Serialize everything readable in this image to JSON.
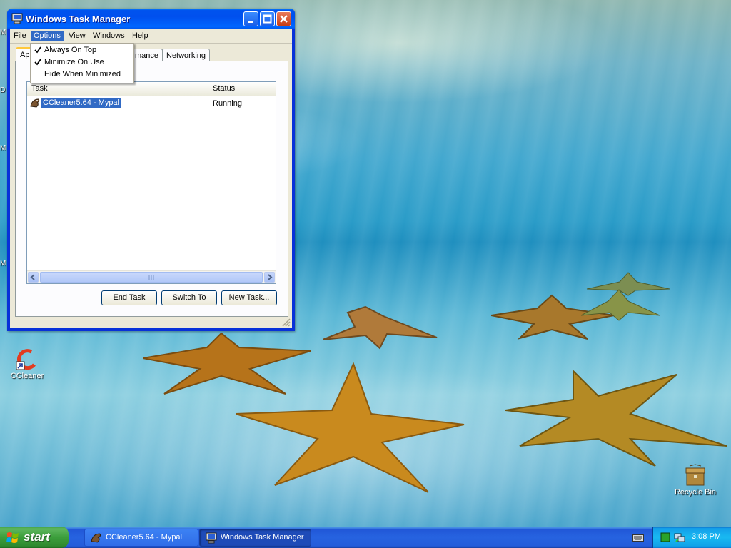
{
  "desktop": {
    "icons": [
      {
        "label": "CCleaner"
      },
      {
        "label": "Recycle Bin"
      }
    ],
    "edge_labels": [
      "M",
      "D",
      "M",
      "M"
    ]
  },
  "window": {
    "title": "Windows Task Manager",
    "menu": [
      "File",
      "Options",
      "View",
      "Windows",
      "Help"
    ],
    "active_menu": "Options",
    "tabs": [
      {
        "label": "App"
      },
      {
        "label": "mance"
      },
      {
        "label": "Networking"
      }
    ],
    "options_menu": [
      {
        "label": "Always On Top",
        "checked": true
      },
      {
        "label": "Minimize On Use",
        "checked": true
      },
      {
        "label": "Hide When Minimized",
        "checked": false
      }
    ],
    "list": {
      "columns": [
        "Task",
        "Status"
      ],
      "rows": [
        {
          "task": "CCleaner5.64 - Mypal",
          "status": "Running"
        }
      ]
    },
    "buttons": {
      "end_task": "End Task",
      "switch_to": "Switch To",
      "new_task": "New Task..."
    }
  },
  "taskbar": {
    "start_label": "start",
    "tasks": [
      {
        "label": "CCleaner5.64 - Mypal",
        "active": false
      },
      {
        "label": "Windows Task Manager",
        "active": true
      }
    ],
    "clock": "3:08 PM"
  },
  "colors": {
    "title_bar": "#0053ee",
    "selection": "#316ac5",
    "start_button": "#3c9e3c",
    "taskbar": "#245ddb"
  }
}
